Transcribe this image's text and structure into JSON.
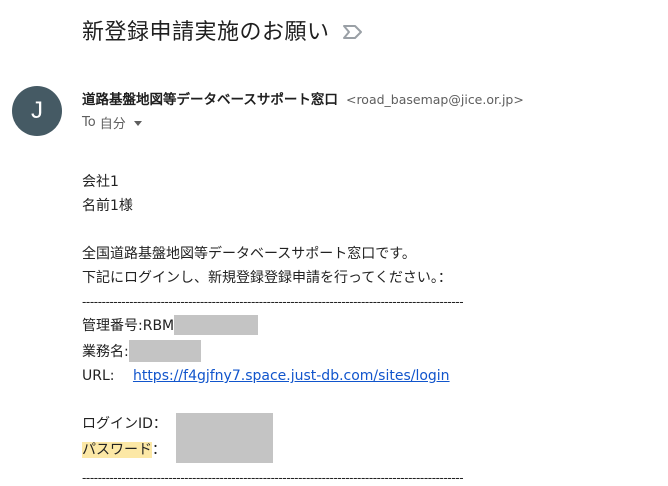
{
  "email": {
    "subject": "新登録申請実施のお願い",
    "label_icon": "label-important-icon",
    "sender": {
      "avatar_letter": "J",
      "avatar_color": "#455a64",
      "name": "道路基盤地図等データベースサポート窓口",
      "email": "<road_basemap@jice.or.jp>"
    },
    "recipient": {
      "to_label": "To",
      "value": "自分"
    },
    "body": {
      "company": "会社1",
      "name": "名前1様",
      "greeting": "全国道路基盤地図等データベースサポート窓口です。",
      "instruction": "下記にログインし、新規登録登録申請を行ってください。：",
      "divider": "-------------------------------------------------------------------------------------------------",
      "management_number_label": "管理番号:RBM",
      "business_name_label": "業務名:",
      "url_label": "URL:",
      "url": "https://f4gjfny7.space.just-db.com/sites/login",
      "login_id_label": "ログインID：",
      "password_label": "パスワード",
      "password_colon": "："
    }
  }
}
